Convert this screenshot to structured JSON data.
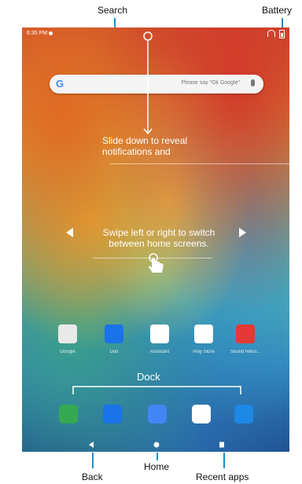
{
  "callouts": {
    "search": "Search",
    "battery": "Battery",
    "home": "Home",
    "back": "Back",
    "recent": "Recent apps"
  },
  "status": {
    "time": "6:35 PM"
  },
  "search_bar": {
    "logo": "G",
    "placeholder": "Please say \"Ok Google\""
  },
  "hints": {
    "slide_line1": "Slide down to reveal",
    "slide_line2": "notifications and",
    "swipe_line1": "Swipe left or right to switch",
    "swipe_line2": "between home screens.",
    "dock": "Dock"
  },
  "apps": [
    {
      "label": "Google",
      "icon": "google-folder-icon",
      "color": "#e9e9e9"
    },
    {
      "label": "Duo",
      "icon": "duo-icon",
      "color": "#1a73e8"
    },
    {
      "label": "Assistant",
      "icon": "assistant-icon",
      "color": "#ffffff"
    },
    {
      "label": "Play Store",
      "icon": "play-store-icon",
      "color": "#ffffff"
    },
    {
      "label": "Sound Reco...",
      "icon": "sound-recorder-icon",
      "color": "#e53935"
    }
  ],
  "dock": [
    {
      "icon": "phone-icon",
      "color": "#34a853"
    },
    {
      "icon": "messages-icon",
      "color": "#1a73e8"
    },
    {
      "icon": "files-icon",
      "color": "#4285f4"
    },
    {
      "icon": "chrome-icon",
      "color": "#ffffff"
    },
    {
      "icon": "camera-icon",
      "color": "#1e88e5"
    }
  ],
  "colors": {
    "callout_line": "#1f8fd0",
    "hint_text": "#ffffff"
  }
}
